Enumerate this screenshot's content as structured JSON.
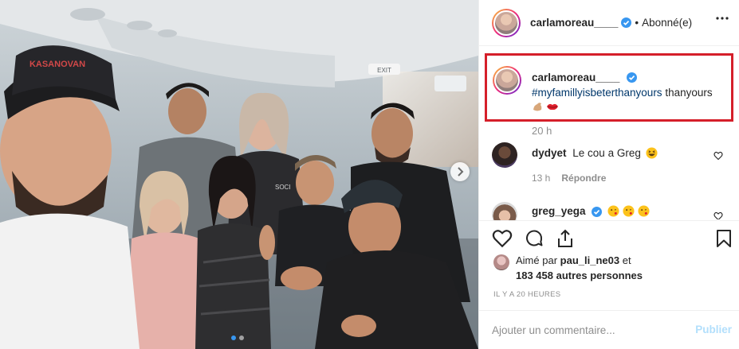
{
  "post": {
    "username": "carlamoreau____",
    "follow_separator": "•",
    "follow_status": "Abonné(e)",
    "caption": {
      "hashtag": "#myfamilly​isbeterthanyours",
      "text": " thanyours",
      "emojis": [
        "flexed-biceps",
        "lips"
      ]
    },
    "caption_time": "20 h",
    "image": {
      "exit_sign": "EXIT",
      "cap_text": "KASANOVAN",
      "shirt_text": "SOCI"
    }
  },
  "comments": [
    {
      "username": "dydyet",
      "text": "Le cou a Greg",
      "emoji": "grinning-squint-face",
      "time": "13 h",
      "reply_label": "Répondre"
    },
    {
      "username": "greg_yega",
      "emojis": [
        "face-kiss",
        "face-kiss",
        "face-kiss"
      ]
    }
  ],
  "likes": {
    "prefix": "Aimé par",
    "user": "pau_li_ne03",
    "connector": "et",
    "others": "183 458 autres personnes"
  },
  "date": "IL Y A 20 HEURES",
  "add_comment": {
    "placeholder": "Ajouter un commentaire...",
    "publish": "Publier"
  },
  "carousel": {
    "count": 2,
    "active": 1
  },
  "colors": {
    "highlight_box": "#d51f2a",
    "verified": "#3897f0",
    "hashtag": "#00376b",
    "publish_disabled": "#b2dffc"
  }
}
